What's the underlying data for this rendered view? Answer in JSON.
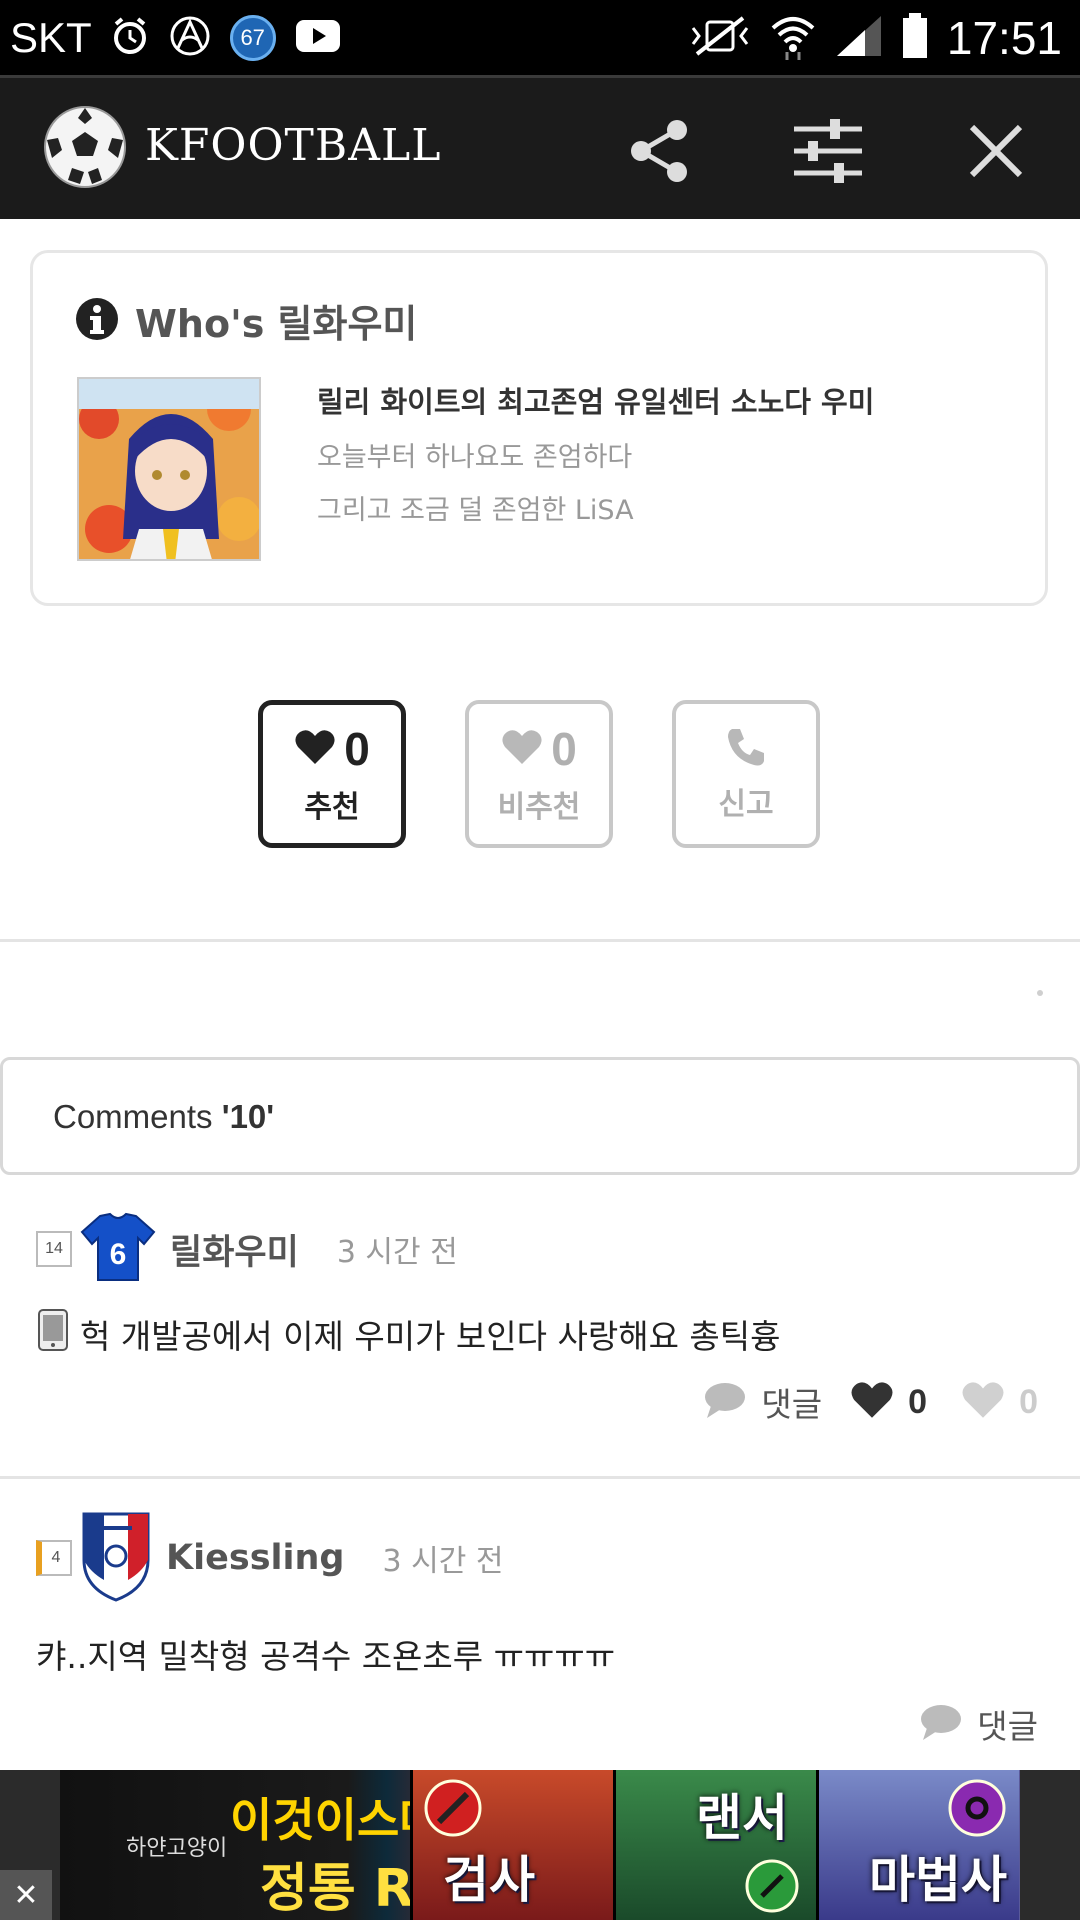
{
  "status_bar": {
    "carrier": "SKT",
    "badge_number": "67",
    "time": "17:51"
  },
  "app_bar": {
    "title": "KFOOTBALL"
  },
  "who": {
    "title": "Who's 릴화우미",
    "line1": "릴리 화이트의 최고존엄 유일센터 소노다 우미",
    "line2": "오늘부터 하나요도 존엄하다",
    "line3": "그리고 조금 덜 존엄한 LiSA"
  },
  "votes": {
    "recommend": {
      "count": "0",
      "label": "추천"
    },
    "not_recommend": {
      "count": "0",
      "label": "비추천"
    },
    "report": {
      "label": "신고"
    }
  },
  "comments_header": {
    "prefix": "Comments ",
    "count": "'10'"
  },
  "comments": [
    {
      "level": "14",
      "jersey_number": "6",
      "name": "릴화우미",
      "time": "3 시간 전",
      "text": "헉 개발공에서 이제 우미가 보인다 사랑해요 총틱흉",
      "reply_label": "댓글",
      "likes": "0",
      "dislikes": "0"
    },
    {
      "level": "4",
      "name": "Kiessling",
      "time": "3 시간 전",
      "text": "캬..지역 밀착형 공격수 조욘초루 ㅠㅠㅠㅠ",
      "reply_label": "댓글"
    }
  ],
  "ad": {
    "small_text": "하얀고양이",
    "line1": "이것이스마트폰",
    "line2": "정통 RPG",
    "tiles": [
      "검사",
      "랜서",
      "마법사"
    ],
    "close_label": "✕"
  }
}
